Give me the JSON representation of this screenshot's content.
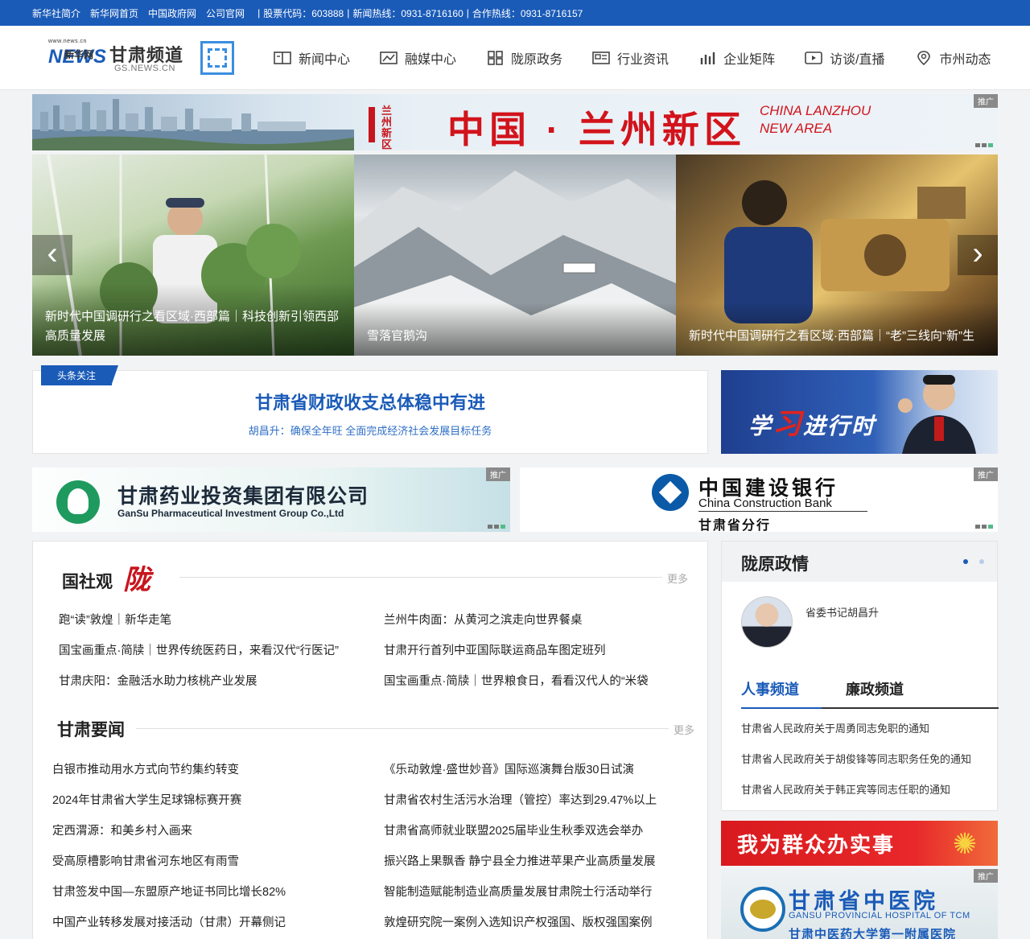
{
  "topbar": {
    "links": [
      "新华社简介",
      "新华网首页",
      "中国政府网",
      "公司官网"
    ],
    "stock": "股票代码：603888",
    "hotline": "新闻热线：0931-8716160",
    "coop": "合作热线：0931-8716157"
  },
  "logo": {
    "small": "www.news.cn",
    "xinhua": "新华网",
    "news": "NEWS",
    "channel": "甘肃频道",
    "domain": "GS.NEWS.CN"
  },
  "nav": [
    {
      "label": "新闻中心",
      "icon": "newspaper-icon"
    },
    {
      "label": "融媒中心",
      "icon": "media-icon"
    },
    {
      "label": "陇原政务",
      "icon": "grid-icon"
    },
    {
      "label": "行业资讯",
      "icon": "info-card-icon"
    },
    {
      "label": "企业矩阵",
      "icon": "bar-chart-icon"
    },
    {
      "label": "访谈/直播",
      "icon": "play-icon"
    },
    {
      "label": "市州动态",
      "icon": "location-icon"
    }
  ],
  "banner_top": {
    "logo_text": "兰州新区",
    "logo_en": "LANZHOU NEW AREA",
    "title": "中国 · 兰州新区",
    "en_line1": "CHINA LANZHOU",
    "en_line2": "NEW AREA",
    "ad_tag": "推广"
  },
  "slider": {
    "slides": [
      {
        "caption": "新时代中国调研行之看区域·西部篇｜科技创新引领西部高质量发展"
      },
      {
        "caption": "雪落官鹅沟"
      },
      {
        "caption": "新时代中国调研行之看区域·西部篇｜“老”三线向“新”生"
      }
    ],
    "prev": "‹",
    "next": "›"
  },
  "headline": {
    "tag": "头条关注",
    "title": "甘肃省财政收支总体稳中有进",
    "sub": "胡昌升：确保全年旺 全面完成经济社会发展目标任务"
  },
  "study": {
    "part1": "学",
    "part2": "习",
    "part3": "进行时"
  },
  "ads": {
    "pharma_cn": "甘肃药业投资集团有限公司",
    "pharma_en": "GanSu Pharmaceutical Investment Group Co.,Ltd",
    "ccb_cn": "中国建设银行",
    "ccb_en": "China Construction Bank",
    "ccb_branch": "甘肃省分行",
    "tag": "推广"
  },
  "guoshe": {
    "title": "国社观",
    "brush": "陇",
    "more": "更多",
    "items": [
      "跑“读”敦煌｜新华走笔",
      "兰州牛肉面：从黄河之滨走向世界餐桌",
      "国宝画重点·简牍｜世界传统医药日，来看汉代“行医记”",
      "甘肃开行首列中亚国际联运商品车图定班列",
      "甘肃庆阳：金融活水助力核桃产业发展",
      "国宝画重点·简牍｜世界粮食日，看看汉代人的“米袋"
    ]
  },
  "gansu_news": {
    "title": "甘肃要闻",
    "more": "更多",
    "items": [
      "白银市推动用水方式向节约集约转变",
      "《乐动敦煌·盛世妙音》国际巡演舞台版30日试演",
      "2024年甘肃省大学生足球锦标赛开赛",
      "甘肃省农村生活污水治理（管控）率达到29.47%以上",
      "定西渭源：和美乡村入画来",
      "甘肃省高师就业联盟2025届毕业生秋季双选会举办",
      "受高原槽影响甘肃省河东地区有雨雪",
      "振兴路上果飘香 静宁县全力推进苹果产业高质量发展",
      "甘肃签发中国—东盟原产地证书同比增长82%",
      "智能制造赋能制造业高质量发展甘肃院士行活动举行",
      "中国产业转移发展对接活动（甘肃）开幕侧记",
      "敦煌研究院一案例入选知识产权强国、版权强国案例"
    ]
  },
  "side": {
    "title": "陇原政情",
    "leader": "省委书记胡昌升",
    "tabs": [
      "人事频道",
      "廉政频道"
    ],
    "items": [
      "甘肃省人民政府关于周勇同志免职的通知",
      "甘肃省人民政府关于胡俊锋等同志职务任免的通知",
      "甘肃省人民政府关于韩正宾等同志任职的通知"
    ]
  },
  "wq": {
    "text": "我为群众办实事"
  },
  "hospital": {
    "cn": "甘肃省中医院",
    "en": "GANSU PROVINCIAL HOSPITAL OF TCM",
    "sub": "甘肃中医药大学第一附属医院",
    "tag": "推广"
  }
}
